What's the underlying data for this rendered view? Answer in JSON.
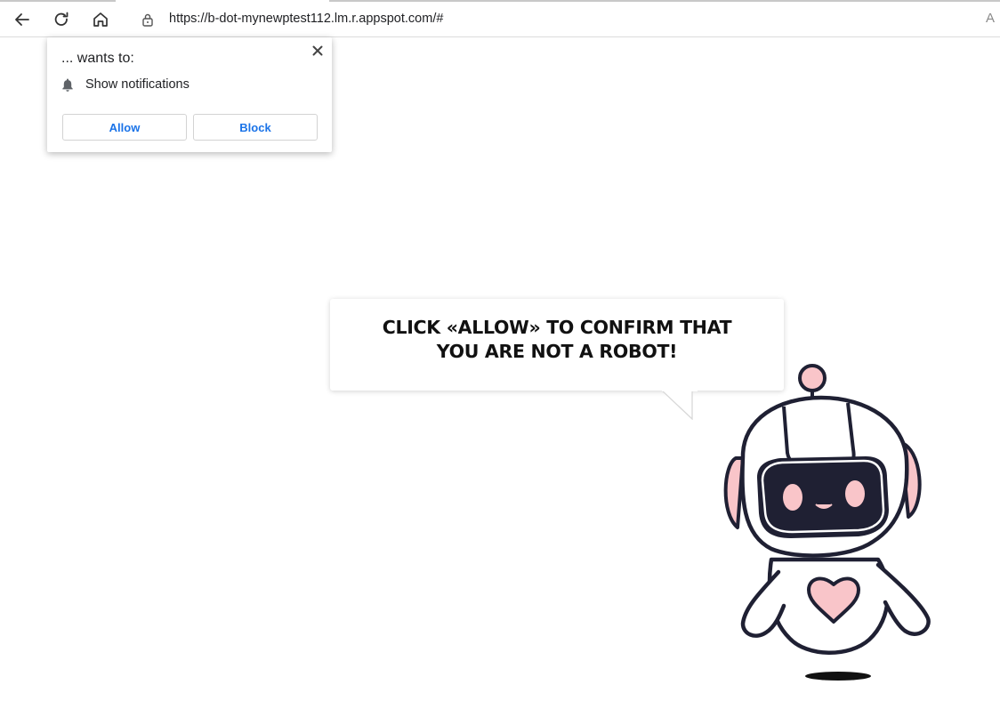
{
  "browser": {
    "url": "https://b-dot-mynewptest112.lm.r.appspot.com/#",
    "icons": [
      "back-icon",
      "reload-icon",
      "home-icon",
      "lock-icon",
      "reader-icon"
    ],
    "reader_glyph": "A"
  },
  "permission_popup": {
    "title": "... wants to:",
    "permission": "Show notifications",
    "allow_label": "Allow",
    "block_label": "Block",
    "accent_color": "#1a73e8"
  },
  "page": {
    "message": "CLICK «ALLOW» TO CONFIRM THAT YOU ARE NOT A ROBOT!",
    "colors": {
      "robot_outline": "#1f2033",
      "robot_pink": "#f9c5c9",
      "visor": "#1f2033"
    }
  }
}
